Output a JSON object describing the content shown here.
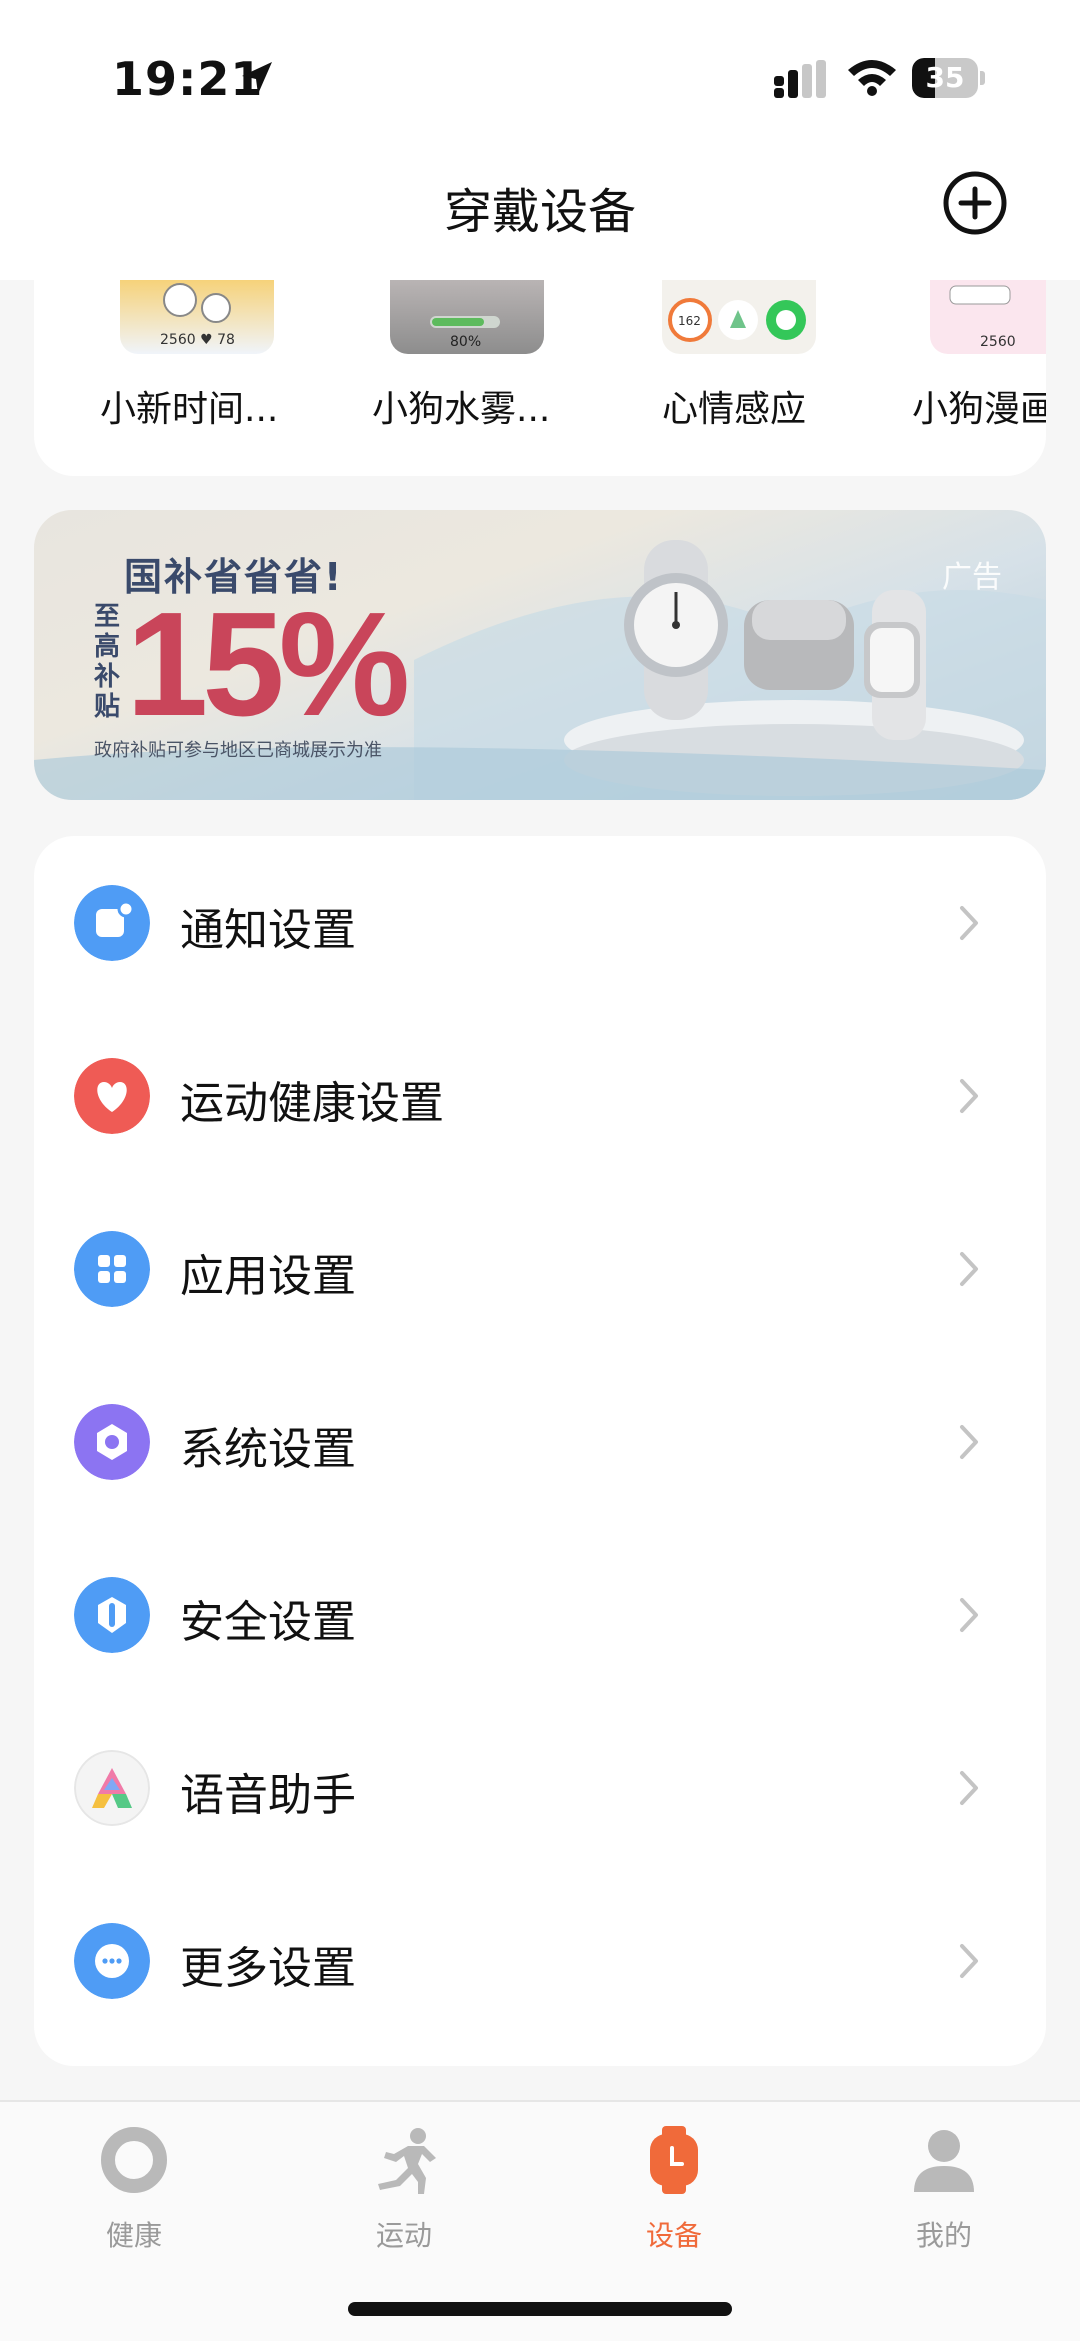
{
  "status": {
    "time": "19:21",
    "battery": "35",
    "battery_level": 0.35
  },
  "header": {
    "title": "穿戴设备"
  },
  "watch_faces": [
    {
      "label": "小新时间...",
      "thumb_text": "2560 ♥ 78"
    },
    {
      "label": "小狗水雾...",
      "thumb_text": "80%"
    },
    {
      "label": "心情感应",
      "thumb_text": "162"
    },
    {
      "label": "小狗漫画",
      "thumb_text": "2560"
    }
  ],
  "banner": {
    "title": "国补省省省!",
    "side_text": "至高补贴",
    "percent": "15%",
    "note": "政府补贴可参与地区已商城展示为准",
    "ad_tag": "广告"
  },
  "settings": [
    {
      "label": "通知设置",
      "icon": "notification-icon",
      "color": "#4f9cf5"
    },
    {
      "label": "运动健康设置",
      "icon": "heart-icon",
      "color": "#ef5b55"
    },
    {
      "label": "应用设置",
      "icon": "apps-grid-icon",
      "color": "#4f9cf5"
    },
    {
      "label": "系统设置",
      "icon": "system-gear-icon",
      "color": "#8c74f2"
    },
    {
      "label": "安全设置",
      "icon": "shield-icon",
      "color": "#4f9cf5"
    },
    {
      "label": "语音助手",
      "icon": "voice-assistant-icon",
      "color": "#f2f2f2"
    },
    {
      "label": "更多设置",
      "icon": "more-dots-icon",
      "color": "#4f9cf5"
    }
  ],
  "tabs": [
    {
      "label": "健康",
      "icon": "health-ring-icon",
      "active": false
    },
    {
      "label": "运动",
      "icon": "running-icon",
      "active": false
    },
    {
      "label": "设备",
      "icon": "watch-icon",
      "active": true
    },
    {
      "label": "我的",
      "icon": "profile-icon",
      "active": false
    }
  ],
  "colors": {
    "accent": "#f06a3a",
    "inactive": "#9a9a9a"
  }
}
